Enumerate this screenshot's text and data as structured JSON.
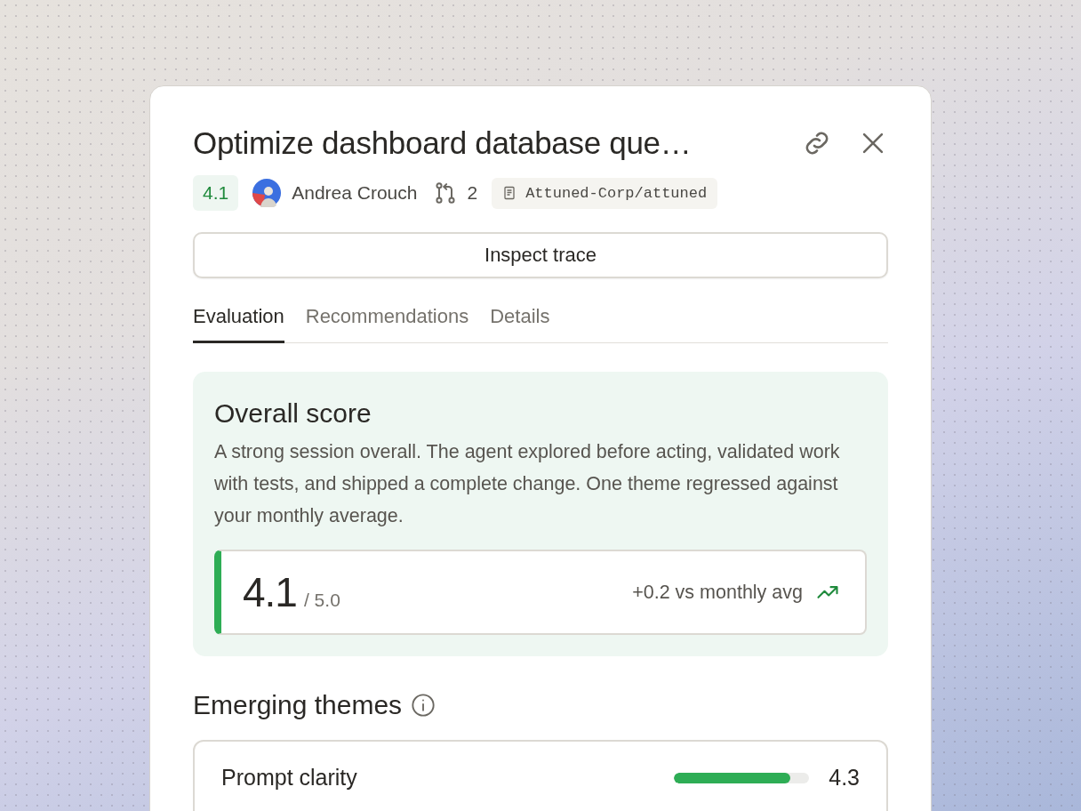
{
  "title": "Optimize dashboard database que…",
  "meta": {
    "score": "4.1",
    "author": "Andrea Crouch",
    "pr_count": "2",
    "repo": "Attuned-Corp/attuned"
  },
  "inspect_button": "Inspect trace",
  "tabs": [
    {
      "label": "Evaluation",
      "selected": true
    },
    {
      "label": "Recommendations",
      "selected": false
    },
    {
      "label": "Details",
      "selected": false
    }
  ],
  "overall": {
    "heading": "Overall score",
    "summary": "A strong session overall. The agent explored before acting, validated work with tests, and shipped a complete change. One theme regressed against your monthly average.",
    "score": "4.1",
    "max": "/ 5.0",
    "delta": "+0.2 vs monthly avg"
  },
  "themes": {
    "heading": "Emerging themes",
    "items": [
      {
        "name": "Prompt clarity",
        "level": 0.86,
        "score": "4.3"
      }
    ]
  }
}
